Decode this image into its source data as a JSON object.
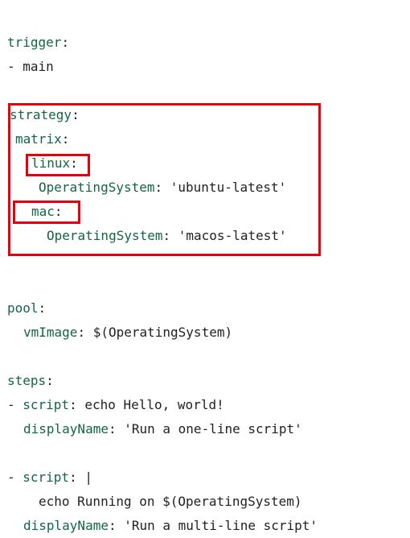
{
  "colors": {
    "key": "#116644",
    "text": "#222222",
    "highlight": "#e8000b",
    "background": "#ffffff"
  },
  "lines": {
    "l1": {
      "key": "trigger",
      "colon": ":"
    },
    "l2": {
      "dash": "- ",
      "value": "main"
    },
    "l3": {
      "key": "strategy",
      "colon": ":"
    },
    "l4": {
      "key": "matrix",
      "colon": ":"
    },
    "l5": {
      "key": "linux",
      "colon": ":"
    },
    "l6": {
      "key": "OperatingSystem",
      "colon": ": ",
      "value": "'ubuntu-latest'"
    },
    "l7": {
      "key": "mac",
      "colon": ":"
    },
    "l8": {
      "key": "OperatingSystem",
      "colon": ": ",
      "value": "'macos-latest'"
    },
    "l9": {
      "key": "pool",
      "colon": ":"
    },
    "l10": {
      "key": "vmImage",
      "colon": ": ",
      "value": "$(OperatingSystem)"
    },
    "l11": {
      "key": "steps",
      "colon": ":"
    },
    "l12": {
      "dash": "- ",
      "key": "script",
      "colon": ": ",
      "value": "echo Hello, world!"
    },
    "l13": {
      "key": "displayName",
      "colon": ": ",
      "value": "'Run a one-line script'"
    },
    "l14": {
      "dash": "- ",
      "key": "script",
      "colon": ": ",
      "value": "|"
    },
    "l15": {
      "value": "echo Running on $(OperatingSystem)"
    },
    "l16": {
      "key": "displayName",
      "colon": ": ",
      "value": "'Run a multi-line script'"
    }
  }
}
